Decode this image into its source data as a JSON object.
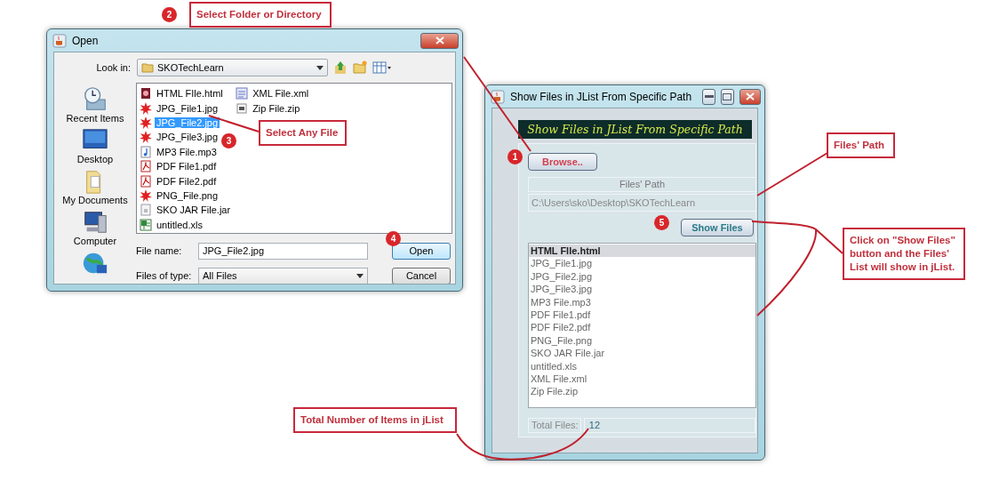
{
  "open_dialog": {
    "title": "Open",
    "look_in": {
      "label": "Look in:",
      "value": "SKOTechLearn"
    },
    "places": [
      {
        "label": "Recent Items",
        "kind": "recent"
      },
      {
        "label": "Desktop",
        "kind": "desktop"
      },
      {
        "label": "My Documents",
        "kind": "documents"
      },
      {
        "label": "Computer",
        "kind": "computer"
      },
      {
        "kind": "network"
      }
    ],
    "files": [
      {
        "name": "HTML FIle.html",
        "kind": "html",
        "selected": false
      },
      {
        "name": "JPG_File1.jpg",
        "kind": "image",
        "selected": false
      },
      {
        "name": "JPG_File2.jpg",
        "kind": "image",
        "selected": true
      },
      {
        "name": "JPG_File3.jpg",
        "kind": "image",
        "selected": false
      },
      {
        "name": "MP3 File.mp3",
        "kind": "audio",
        "selected": false
      },
      {
        "name": "PDF File1.pdf",
        "kind": "pdf",
        "selected": false
      },
      {
        "name": "PDF File2.pdf",
        "kind": "pdf",
        "selected": false
      },
      {
        "name": "PNG_File.png",
        "kind": "image",
        "selected": false
      },
      {
        "name": "SKO JAR File.jar",
        "kind": "jar",
        "selected": false
      },
      {
        "name": "untitled.xls",
        "kind": "spreadsheet",
        "selected": false
      },
      {
        "name": "XML File.xml",
        "kind": "xml",
        "selected": false
      },
      {
        "name": "Zip File.zip",
        "kind": "archive",
        "selected": false
      }
    ],
    "file_name": {
      "label": "File name:",
      "value": "JPG_File2.jpg"
    },
    "file_type": {
      "label": "Files of type:",
      "value": "All Files"
    },
    "buttons": [
      "Open",
      "Cancel"
    ]
  },
  "show_window": {
    "title": "Show Files in JList From Specific Path",
    "heading": "Show Files in JList From Specific Path",
    "browse_button": "Browse..",
    "path_label": "Files' Path",
    "path": "C:\\Users\\sko\\Desktop\\SKOTechLearn",
    "show_button": "Show Files",
    "list": [
      {
        "name": "HTML FIle.html",
        "selected": true
      },
      {
        "name": "JPG_File1.jpg",
        "selected": false
      },
      {
        "name": "JPG_File2.jpg",
        "selected": false
      },
      {
        "name": "JPG_File3.jpg",
        "selected": false
      },
      {
        "name": "MP3 File.mp3",
        "selected": false
      },
      {
        "name": "PDF File1.pdf",
        "selected": false
      },
      {
        "name": "PDF File2.pdf",
        "selected": false
      },
      {
        "name": "PNG_File.png",
        "selected": false
      },
      {
        "name": "SKO JAR File.jar",
        "selected": false
      },
      {
        "name": "untitled.xls",
        "selected": false
      },
      {
        "name": "XML File.xml",
        "selected": false
      },
      {
        "name": "Zip File.zip",
        "selected": false
      }
    ],
    "total_label": "Total Files:",
    "total": "12"
  },
  "annotations": [
    {
      "kind": "step",
      "text": "2"
    },
    {
      "kind": "callout",
      "text": "Select Folder or Directory"
    },
    {
      "kind": "step",
      "text": "3"
    },
    {
      "kind": "callout",
      "text": "Select Any File"
    },
    {
      "kind": "step",
      "text": "4"
    },
    {
      "kind": "step",
      "text": "1"
    },
    {
      "kind": "step",
      "text": "5"
    },
    {
      "kind": "callout",
      "text": "Files' Path"
    },
    {
      "kind": "callout",
      "text": "Click on \"Show Files\" button and the Files' List will show in jList."
    },
    {
      "kind": "callout",
      "text": "Total Number of Items in jList"
    }
  ]
}
